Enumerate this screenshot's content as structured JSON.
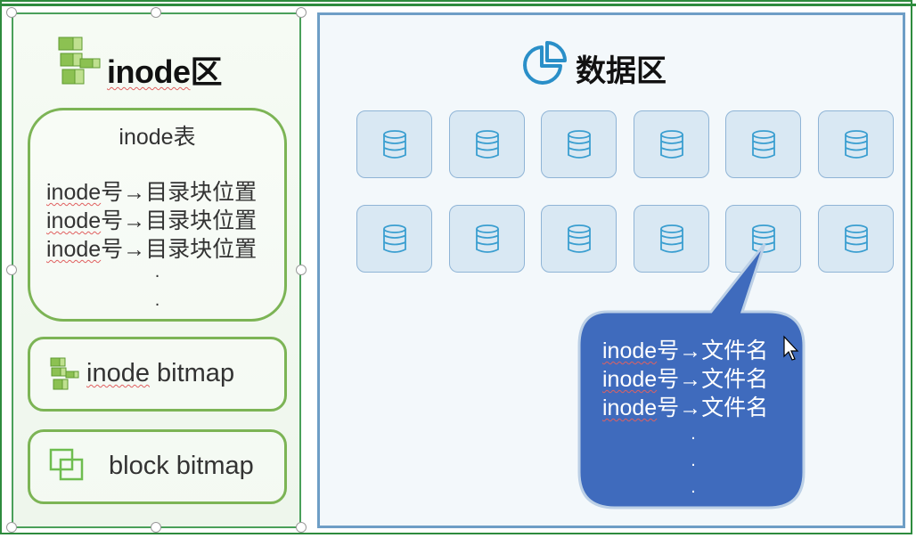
{
  "left": {
    "title": "inode区",
    "title_prefix": "inode",
    "title_suffix": "区",
    "table": {
      "title": "inode表",
      "rows": [
        {
          "prefix": "inode",
          "text": "号→目录块位置"
        },
        {
          "prefix": "inode",
          "text": "号→目录块位置"
        },
        {
          "prefix": "inode",
          "text": "号→目录块位置"
        }
      ],
      "dots": [
        ".",
        "."
      ]
    },
    "inode_bitmap": {
      "prefix": "inode",
      "text": " bitmap"
    },
    "block_bitmap": {
      "label": "block bitmap"
    }
  },
  "right": {
    "title": "数据区",
    "blocks_rows": 2,
    "blocks_cols": 6,
    "bubble": {
      "rows": [
        {
          "prefix": "inode",
          "text": "号→文件名"
        },
        {
          "prefix": "inode",
          "text": "号→文件名"
        },
        {
          "prefix": "inode",
          "text": "号→文件名"
        }
      ],
      "dots": [
        ".",
        ".",
        "."
      ]
    }
  },
  "colors": {
    "green_border": "#4aa05a",
    "box_border": "#7cb455",
    "blue_border": "#6e9ec6",
    "block_fill": "#d9e8f3",
    "bubble_fill": "#3f6bbd",
    "db_icon": "#3a9ed0"
  },
  "icons": {
    "left_title": "cubes-icon",
    "inode_bitmap": "cubes-icon",
    "block_bitmap": "overlapping-squares-icon",
    "right_title": "pie-chart-icon",
    "block": "database-icon"
  }
}
